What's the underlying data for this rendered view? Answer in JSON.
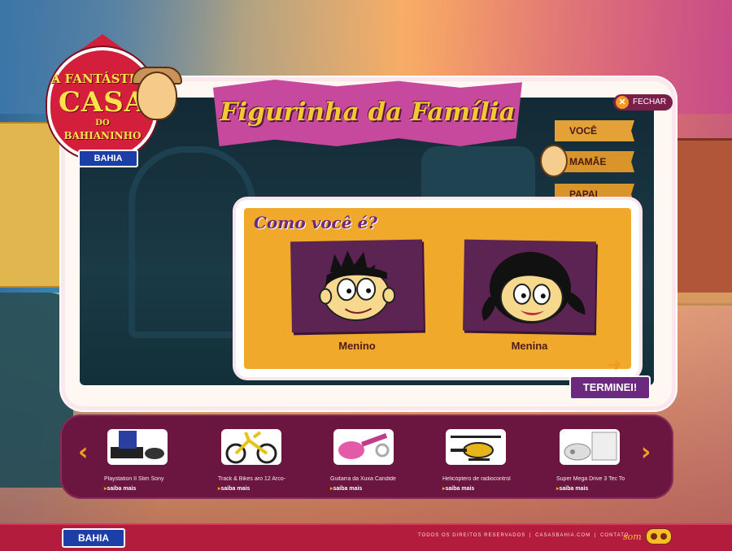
{
  "logo": {
    "line1": "A",
    "line2": "FANTÁSTICA",
    "line3": "CASA",
    "line4": "DO",
    "line5": "BAHIANINHO",
    "badge": "BAHIA"
  },
  "header": {
    "title": "Figurinha da Família",
    "close_label": "FECHAR"
  },
  "tabs": [
    {
      "label": "VOCÊ"
    },
    {
      "label": "MAMÃE"
    },
    {
      "label": "PAPAI"
    }
  ],
  "choice": {
    "question": "Como você é?",
    "options": [
      {
        "label": "Menino"
      },
      {
        "label": "Menina"
      }
    ],
    "finish_label": "TERMINEI!"
  },
  "products": [
    {
      "name": "Playstation II Slim Sony",
      "more": "saiba mais"
    },
    {
      "name": "Track & Bikes aro 12 Arco-",
      "more": "saiba mais"
    },
    {
      "name": "Guitarra da Xuxa Candide",
      "more": "saiba mais"
    },
    {
      "name": "Helicóptero de radiocontrol",
      "more": "saiba mais"
    },
    {
      "name": "Super Mega Drive 3 Tec To",
      "more": "saiba mais"
    }
  ],
  "footer": {
    "logo": "BAHIA",
    "rights": "TODOS OS DIREITOS RESERVADOS",
    "site": "CASASBAHIA.COM",
    "contact": "CONTATO",
    "sound_label": "som"
  },
  "colors": {
    "accent_purple": "#6b2a7d",
    "accent_orange": "#f0a92a",
    "brand_blue": "#1b3fa6",
    "footer_red": "#b31c3c"
  },
  "icons": [
    "close-icon",
    "chevron-left-icon",
    "chevron-right-icon",
    "sound-icon",
    "finish-arrow-icon"
  ]
}
